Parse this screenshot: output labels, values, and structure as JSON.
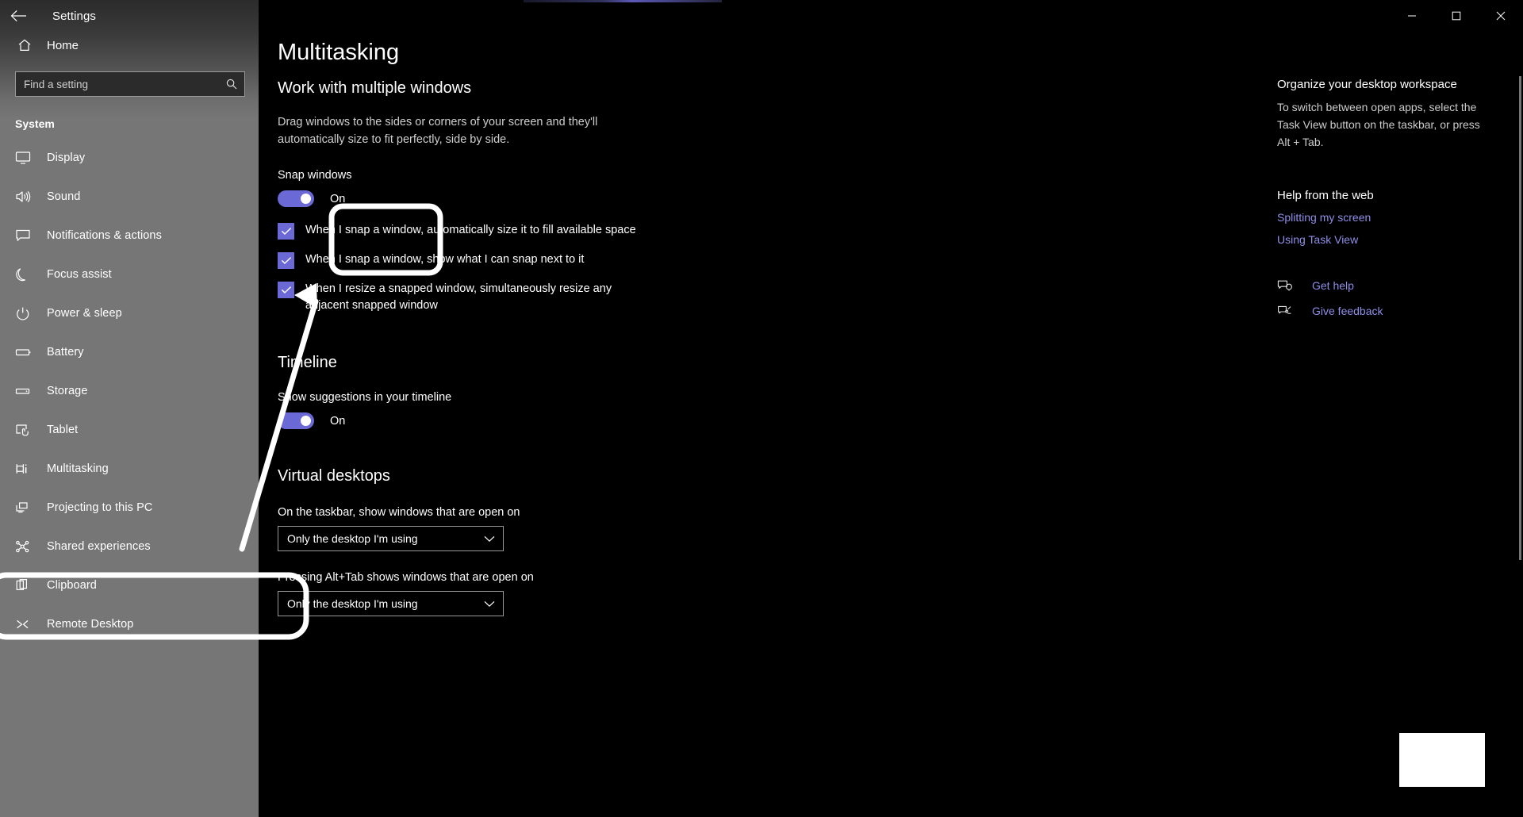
{
  "window": {
    "title": "Settings",
    "back_icon": "back-arrow-icon",
    "minimize_icon": "minimize-icon",
    "maximize_icon": "maximize-icon",
    "close_icon": "close-icon"
  },
  "sidebar": {
    "home_label": "Home",
    "home_icon": "home-icon",
    "search": {
      "placeholder": "Find a setting",
      "value": "",
      "icon": "search-icon"
    },
    "category": "System",
    "items": [
      {
        "label": "Display",
        "icon": "monitor-icon",
        "selected": false
      },
      {
        "label": "Sound",
        "icon": "speaker-icon",
        "selected": false
      },
      {
        "label": "Notifications & actions",
        "icon": "chat-bubble-icon",
        "selected": false
      },
      {
        "label": "Focus assist",
        "icon": "moon-icon",
        "selected": false
      },
      {
        "label": "Power & sleep",
        "icon": "power-icon",
        "selected": false
      },
      {
        "label": "Battery",
        "icon": "battery-icon",
        "selected": false
      },
      {
        "label": "Storage",
        "icon": "storage-drive-icon",
        "selected": false
      },
      {
        "label": "Tablet",
        "icon": "tablet-touch-icon",
        "selected": false
      },
      {
        "label": "Multitasking",
        "icon": "multitasking-icon",
        "selected": true
      },
      {
        "label": "Projecting to this PC",
        "icon": "project-screen-icon",
        "selected": false
      },
      {
        "label": "Shared experiences",
        "icon": "share-nodes-icon",
        "selected": false
      },
      {
        "label": "Clipboard",
        "icon": "clipboard-icon",
        "selected": false
      },
      {
        "label": "Remote Desktop",
        "icon": "remote-desktop-icon",
        "selected": false
      }
    ]
  },
  "main": {
    "page_title": "Multitasking",
    "snap_section": {
      "heading": "Work with multiple windows",
      "description": "Drag windows to the sides or corners of your screen and they'll automatically size to fit perfectly, side by side.",
      "toggle_label": "Snap windows",
      "toggle_state": "On",
      "toggle_on": true,
      "checkboxes": [
        {
          "label": "When I snap a window, automatically size it to fill available space",
          "checked": true
        },
        {
          "label": "When I snap a window, show what I can snap next to it",
          "checked": true
        },
        {
          "label": "When I resize a snapped window, simultaneously resize any adjacent snapped window",
          "checked": true
        }
      ]
    },
    "timeline_section": {
      "heading": "Timeline",
      "toggle_label": "Show suggestions in your timeline",
      "toggle_state": "On",
      "toggle_on": true
    },
    "virtual_desktops_section": {
      "heading": "Virtual desktops",
      "taskbar_label": "On the taskbar, show windows that are open on",
      "taskbar_value": "Only the desktop I'm using",
      "alttab_label": "Pressing Alt+Tab shows windows that are open on",
      "alttab_value": "Only the desktop I'm using",
      "chevron_icon": "chevron-down-icon"
    }
  },
  "rail": {
    "organize_heading": "Organize your desktop workspace",
    "organize_body": "To switch between open apps, select the Task View button on the taskbar, or press Alt + Tab.",
    "help_heading": "Help from the web",
    "links": [
      "Splitting my screen",
      "Using Task View"
    ],
    "get_help_label": "Get help",
    "get_help_icon": "get-help-icon",
    "give_feedback_label": "Give feedback",
    "give_feedback_icon": "give-feedback-icon"
  },
  "annotations": {
    "highlight_sidebar_item": "Multitasking",
    "highlight_setting": "Snap windows",
    "arrow": "callout-arrow",
    "accent_color": "#6b69d6",
    "link_color": "#8f8ee8",
    "sidebar_bg": "#767676",
    "content_bg": "#000000"
  }
}
